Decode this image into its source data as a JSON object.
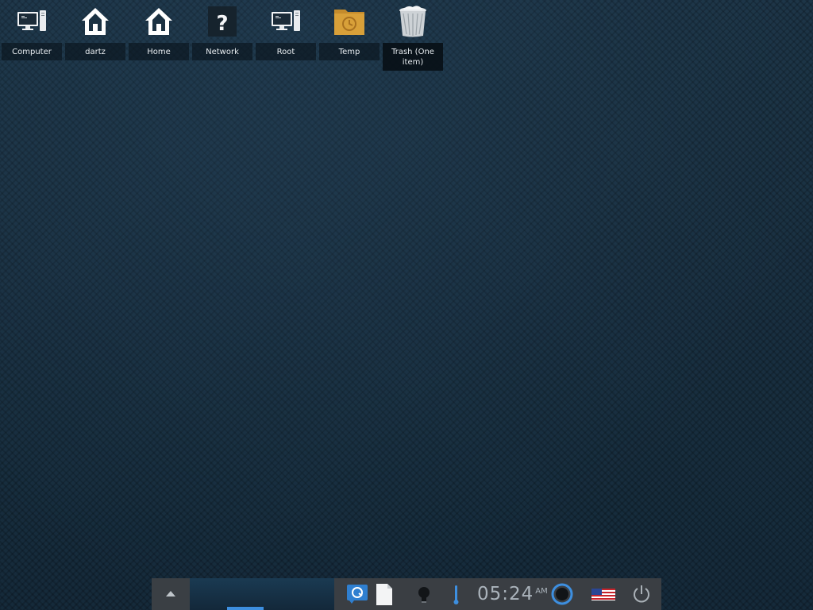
{
  "desktop": {
    "icons": [
      {
        "id": "computer",
        "label": "Computer",
        "icon": "computer-icon"
      },
      {
        "id": "dartz",
        "label": "dartz",
        "icon": "home-folder-icon"
      },
      {
        "id": "home",
        "label": "Home",
        "icon": "home-icon"
      },
      {
        "id": "network",
        "label": "Network",
        "icon": "unknown-question-icon"
      },
      {
        "id": "root",
        "label": "Root",
        "icon": "computer-icon"
      },
      {
        "id": "temp",
        "label": "Temp",
        "icon": "temp-folder-icon"
      },
      {
        "id": "trash",
        "label": "Trash (One item)",
        "icon": "trash-full-icon"
      }
    ]
  },
  "taskbar": {
    "clock": {
      "time": "05:24",
      "period": "AM"
    },
    "tray": [
      {
        "id": "updater",
        "icon": "software-updater-icon"
      },
      {
        "id": "clipboard",
        "icon": "clipboard-document-icon"
      },
      {
        "id": "notifications",
        "icon": "lightbulb-icon"
      },
      {
        "id": "volume",
        "icon": "volume-level-icon"
      },
      {
        "id": "network-status",
        "icon": "network-ring-icon"
      },
      {
        "id": "keyboard-layout",
        "icon": "us-flag-icon"
      },
      {
        "id": "power",
        "icon": "power-icon"
      }
    ],
    "show_panel_icon": "chevron-up-icon"
  },
  "colors": {
    "desktop_background": "#1b3142",
    "taskbar_tray": "#3a3e43",
    "taskbar_accent": "#3d8fe0",
    "clock_text": "#aab3bb",
    "folder_yellow": "#d8a039"
  }
}
